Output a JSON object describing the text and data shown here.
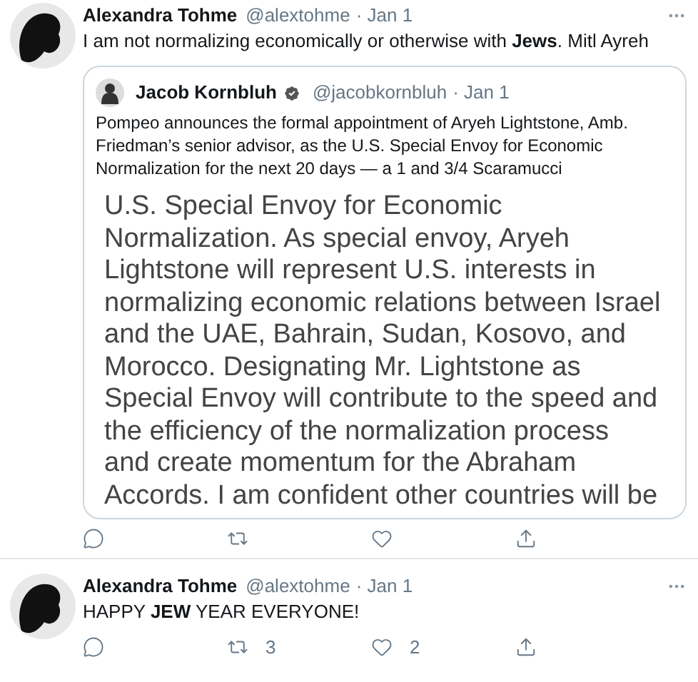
{
  "tweets": [
    {
      "name": "Alexandra Tohme",
      "handle": "@alextohme",
      "date": "· Jan 1",
      "text": "I am not normalizing economically or otherwise with **Jews**. Mitl Ayreh",
      "quote": {
        "name": "Jacob Kornbluh",
        "verified": true,
        "handle": "@jacobkornbluh",
        "date": "· Jan 1",
        "text": "Pompeo announces the formal appointment of Aryeh Lightstone, Amb. Friedman’s senior advisor, as the U.S. Special Envoy for Economic Normalization for the next 20 days —  a 1 and 3/4 Scaramucci",
        "image_lines": [
          "U.S. Special Envoy for Economic",
          "Normalization. As special envoy, Aryeh",
          "Lightstone will represent U.S. interests in",
          "normalizing economic relations between Israel",
          "and the UAE, Bahrain, Sudan, Kosovo, and",
          "Morocco. Designating Mr. Lightstone as",
          "Special Envoy will contribute to the speed and",
          "the efficiency of the normalization process",
          "and create momentum for the Abraham",
          "Accords. I am confident other countries will be"
        ]
      },
      "actions": [
        {
          "kind": "reply"
        },
        {
          "kind": "retweet"
        },
        {
          "kind": "like"
        },
        {
          "kind": "share"
        }
      ]
    },
    {
      "name": "Alexandra Tohme",
      "handle": "@alextohme",
      "date": "· Jan 1",
      "text": "HAPPY **JEW** YEAR EVERYONE!",
      "actions": [
        {
          "kind": "reply"
        },
        {
          "kind": "retweet",
          "count": "3"
        },
        {
          "kind": "like",
          "count": "2"
        },
        {
          "kind": "share"
        }
      ]
    }
  ]
}
